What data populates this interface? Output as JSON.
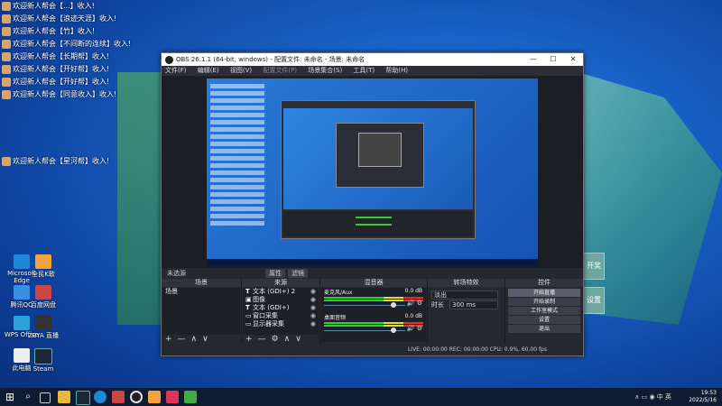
{
  "chat": {
    "lines": [
      "欢迎新人帮会【...】收入!",
      "欢迎新人帮会【浪迹天涯】收入!",
      "欢迎新人帮会【竹】收入!",
      "欢迎新人帮会【不间断的连续】收入!",
      "欢迎新人帮会【长期帮】收入!",
      "欢迎新人帮会【开好帮】收入!",
      "欢迎新人帮会【开好帮】收入!",
      "欢迎新人帮会【同意收入】收入!",
      "欢迎新人帮会【星河帮】收入!"
    ]
  },
  "obs": {
    "title": "OBS 26.1.1 (64-bit, windows) - 配置文件: 未命名 - 场景: 未命名",
    "controls": [
      "—",
      "☐",
      "✕"
    ],
    "menu": [
      "文件(F)",
      "编辑(E)",
      "视图(V)",
      "配置文件(P)",
      "场景集合(S)",
      "工具(T)",
      "帮助(H)"
    ],
    "context_bar": {
      "label": "未选源",
      "btn1": "属性",
      "btn2": "滤镜"
    },
    "scenes": {
      "header": "场景",
      "items": [
        "场景"
      ]
    },
    "sources": {
      "header": "来源",
      "items": [
        {
          "icon": "T",
          "label": "文本 (GDI+) 2"
        },
        {
          "icon": "▣",
          "label": "图像"
        },
        {
          "icon": "T",
          "label": "文本 (GDI+)"
        },
        {
          "icon": "▭",
          "label": "窗口采集"
        },
        {
          "icon": "▭",
          "label": "显示器采集"
        }
      ]
    },
    "mixer": {
      "header": "混音器",
      "channels": [
        {
          "name": "麦克风/Aux",
          "db": "0.0 dB",
          "level": 0.86
        },
        {
          "name": "桌面音频",
          "db": "0.0 dB",
          "level": 0.86
        }
      ]
    },
    "transitions": {
      "header": "转场特效",
      "type": "淡出",
      "duration_label": "时长",
      "duration": "300 ms"
    },
    "controls_dock": {
      "header": "控件",
      "buttons": [
        "开始直播",
        "开始录制",
        "工作室模式",
        "设置",
        "退出"
      ]
    },
    "footer_icons": [
      "+",
      "—",
      "∧",
      "∨"
    ],
    "status": "LIVE: 00:00:00   REC: 00:00:00   CPU: 0.9%, 60.00 fps"
  },
  "side_buttons": [
    "开奖",
    "设置"
  ],
  "desktop_icons": [
    {
      "label": "Microsoft Edge",
      "color": "#1e88d8"
    },
    {
      "label": "全民K歌",
      "color": "#f2a33a"
    },
    {
      "label": "腾讯QQ",
      "color": "#3a8ee6"
    },
    {
      "label": "百度网盘",
      "color": "#c44"
    },
    {
      "label": "WPS Office",
      "color": "#2aa3d8"
    },
    {
      "label": "ZBYA 直播",
      "color": "#333"
    },
    {
      "label": "此电脑",
      "color": "#eee"
    },
    {
      "label": "Steam",
      "color": "#1b2838"
    }
  ],
  "taskbar": {
    "time": "19:53",
    "date": "2022/5/16",
    "tray": "∧  ▭  ◉  中  英"
  }
}
